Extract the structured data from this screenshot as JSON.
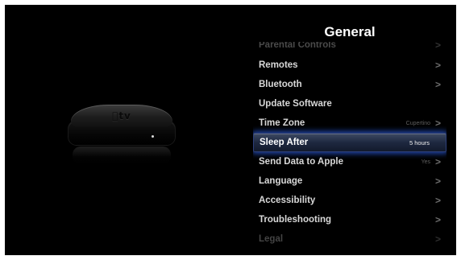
{
  "device": {
    "logo_text": "tv"
  },
  "menu": {
    "title": "General",
    "items": [
      {
        "label": "Parental Controls",
        "value": "",
        "chevron": ">"
      },
      {
        "label": "Remotes",
        "value": "",
        "chevron": ">"
      },
      {
        "label": "Bluetooth",
        "value": "",
        "chevron": ">"
      },
      {
        "label": "Update Software",
        "value": "",
        "chevron": ""
      },
      {
        "label": "Time Zone",
        "value": "Cupertino",
        "chevron": ">"
      },
      {
        "label": "Sleep After",
        "value": "5 hours",
        "chevron": "",
        "selected": true
      },
      {
        "label": "Send Data to Apple",
        "value": "Yes",
        "chevron": ">"
      },
      {
        "label": "Language",
        "value": "",
        "chevron": ">"
      },
      {
        "label": "Accessibility",
        "value": "",
        "chevron": ">"
      },
      {
        "label": "Troubleshooting",
        "value": "",
        "chevron": ">"
      },
      {
        "label": "Legal",
        "value": "",
        "chevron": ">"
      }
    ]
  },
  "colors": {
    "background": "#000000",
    "selection_glow": "#2652c8",
    "text": "#d8d8d8"
  }
}
